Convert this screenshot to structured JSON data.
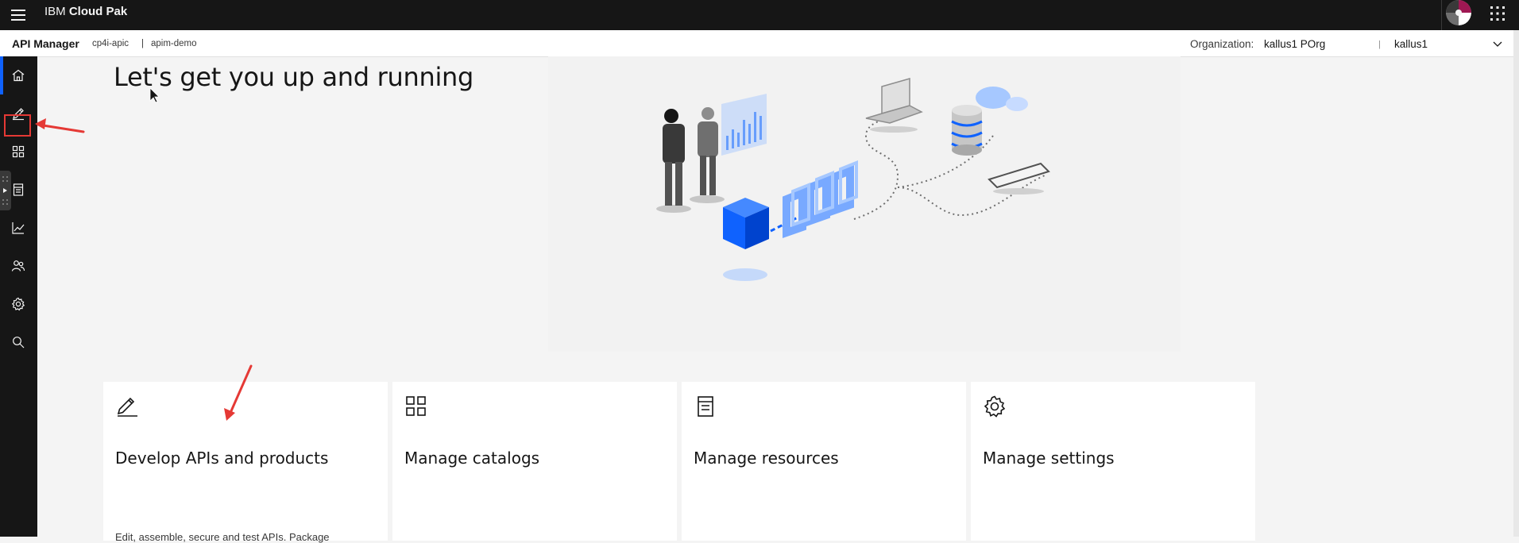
{
  "shell": {
    "brand_prefix": "IBM",
    "brand_name": "Cloud Pak",
    "menu_icon": "hamburger-icon",
    "switcher_icon": "app-switcher-icon"
  },
  "subheader": {
    "app_name": "API Manager",
    "breadcrumb": [
      "cp4i-apic",
      "apim-demo"
    ],
    "breadcrumb_separator": "|",
    "org_label": "Organization:",
    "org_value": "kallus1 POrg",
    "user_separator": "|",
    "user_value": "kallus1"
  },
  "leftnav": {
    "items": [
      {
        "icon": "home-icon",
        "active": true
      },
      {
        "icon": "edit-icon"
      },
      {
        "icon": "grid-icon"
      },
      {
        "icon": "catalog-icon"
      },
      {
        "icon": "analytics-icon"
      },
      {
        "icon": "members-icon"
      },
      {
        "icon": "settings-icon"
      },
      {
        "icon": "search-icon"
      }
    ]
  },
  "hero": {
    "title": "Let's get you up and running"
  },
  "tiles": [
    {
      "title": "Develop APIs and products",
      "desc": "Edit, assemble, secure and test APIs. Package",
      "icon": "edit-icon"
    },
    {
      "title": "Manage catalogs",
      "desc": "",
      "icon": "grid-icon"
    },
    {
      "title": "Manage resources",
      "desc": "",
      "icon": "catalog-icon"
    },
    {
      "title": "Manage settings",
      "desc": "",
      "icon": "settings-icon"
    }
  ],
  "colors": {
    "shell_bg": "#161616",
    "accent": "#0f62fe",
    "annotation": "#e53935",
    "page_bg": "#f4f4f4"
  }
}
